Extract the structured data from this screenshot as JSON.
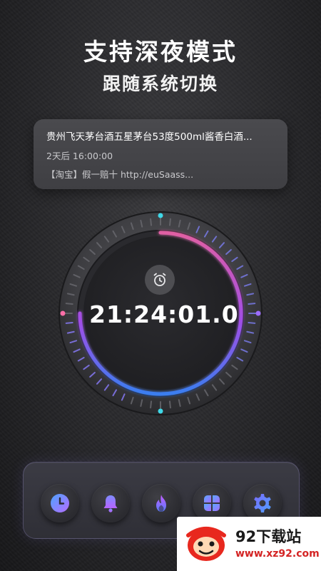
{
  "hero": {
    "headline": "支持深夜模式",
    "subline": "跟随系统切换"
  },
  "notification": {
    "title": "贵州飞天茅台酒五星茅台53度500ml酱香白酒...",
    "time": "2天后 16:00:00",
    "body": "【淘宝】假一赔十 http://euSaass..."
  },
  "clock": {
    "time": "21:24:01.0",
    "progress": 0.75,
    "accent_start": "#e05fa3",
    "accent_mid": "#a04ee6",
    "accent_end": "#3a7ef0",
    "marker_top": "#3fd8e8",
    "marker_left": "#ff6fa8",
    "marker_right": "#9d6cff",
    "marker_bottom": "#3fd8e8"
  },
  "dock": {
    "items": [
      {
        "icon": "clock-icon"
      },
      {
        "icon": "bell-icon"
      },
      {
        "icon": "flame-icon"
      },
      {
        "icon": "grid-icon"
      },
      {
        "icon": "gear-icon"
      }
    ]
  },
  "watermark": {
    "name": "92下载站",
    "url": "www.xz92.com"
  }
}
